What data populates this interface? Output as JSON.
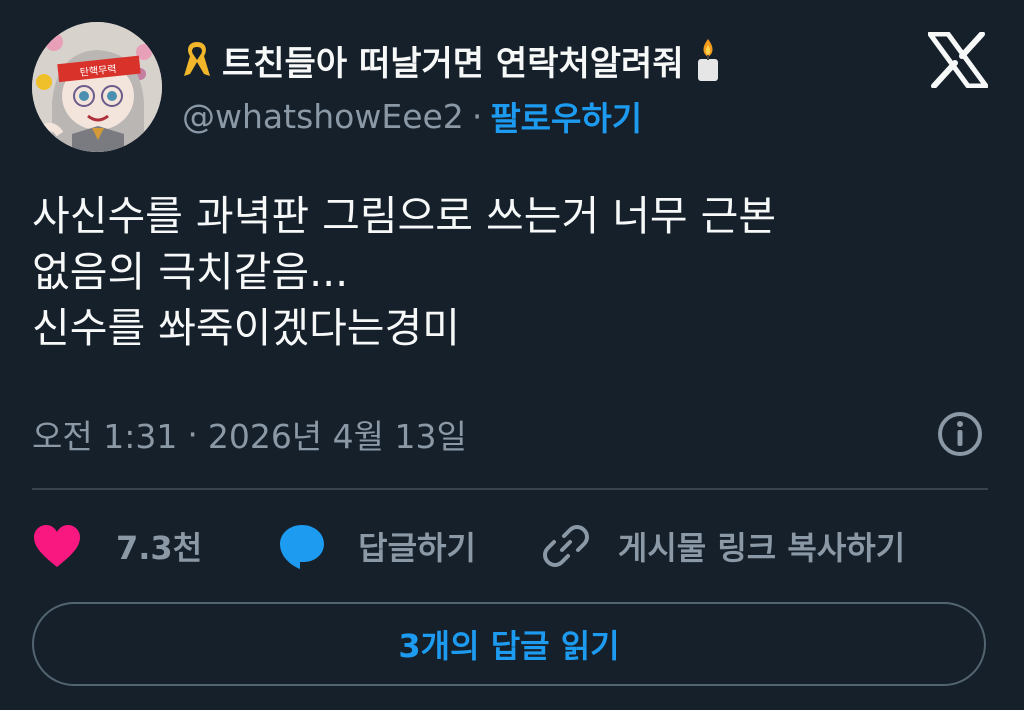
{
  "author": {
    "ribbon_icon": "yellow-ribbon-icon",
    "display_name": "트친들아 떠날거면 연락처알려줘",
    "candle_icon": "candle-icon",
    "handle": "@whatshowEee2",
    "separator": "·",
    "follow_label": "팔로우하기",
    "avatar_headband_text": "탄핵무력"
  },
  "tweet": {
    "lines": [
      "사신수를 과녁판 그림으로 쓰는거 너무 근본",
      "없음의 극치같음...",
      "신수를 쏴죽이겠다는경미"
    ],
    "time": "오전 1:31",
    "separator": "·",
    "date": "2026년 4월 13일"
  },
  "actions": {
    "like_count": "7.3천",
    "reply_label": "답글하기",
    "copy_link_label": "게시물 링크 복사하기"
  },
  "replies_button_label": "3개의 답글 읽기",
  "colors": {
    "background": "#15202b",
    "accent": "#1d9bf0",
    "like": "#f91880",
    "muted": "#8b98a5",
    "divider": "#38444d"
  }
}
